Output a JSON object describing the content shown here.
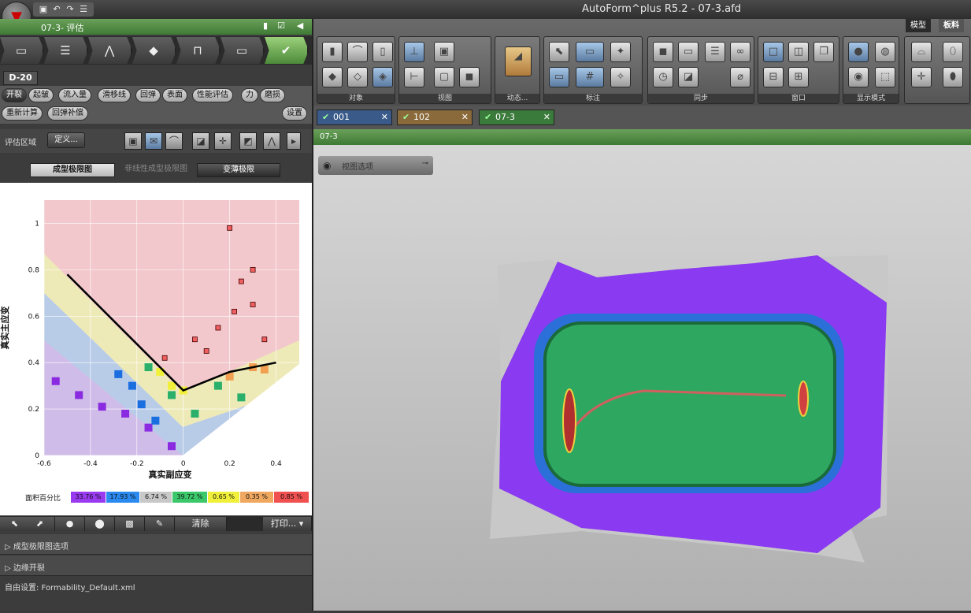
{
  "window": {
    "title": "AutoForm^plus R5.2 - 07-3.afd"
  },
  "left_panel": {
    "header": "07-3- 评估",
    "process_steps": [
      "零件",
      "工序",
      "模面",
      "板料",
      "工艺",
      "文本",
      "评估"
    ],
    "part_tab": "D-20",
    "eval_tabs_row1": [
      "开裂",
      "起皱",
      "流入量",
      "滑移线",
      "回弹",
      "表面",
      "性能评估",
      "力",
      "磨损"
    ],
    "eval_tabs_row2": [
      "重新计算",
      "回弹补偿"
    ],
    "settings_label": "设置",
    "eval_region_label": "评估区域",
    "define_button": "定义...",
    "view_tabs": [
      "成型极限图",
      "非线性成型极限图",
      "变薄极限"
    ]
  },
  "chart_data": {
    "type": "scatter",
    "title": "",
    "xlabel": "真实副应变",
    "ylabel": "真实主应变",
    "xlim": [
      -0.6,
      0.5
    ],
    "ylim": [
      0,
      1.1
    ],
    "x_ticks": [
      "-0.6",
      "-0.4",
      "-0.2",
      "0",
      "0.2",
      "0.4"
    ],
    "y_ticks": [
      "0",
      "0.2",
      "0.4",
      "0.6",
      "0.8",
      "1"
    ],
    "flc_curve": [
      [
        -0.5,
        0.78
      ],
      [
        0.0,
        0.28
      ],
      [
        0.2,
        0.36
      ],
      [
        0.4,
        0.4
      ]
    ],
    "series": [
      {
        "color": "#8a2be2",
        "values": [
          [
            -0.55,
            0.32
          ],
          [
            -0.45,
            0.26
          ],
          [
            -0.35,
            0.21
          ],
          [
            -0.25,
            0.18
          ],
          [
            -0.15,
            0.12
          ],
          [
            -0.05,
            0.04
          ]
        ]
      },
      {
        "color": "#1a6ee0",
        "values": [
          [
            -0.28,
            0.35
          ],
          [
            -0.22,
            0.3
          ],
          [
            -0.18,
            0.22
          ],
          [
            -0.12,
            0.15
          ]
        ]
      },
      {
        "color": "#2ab06a",
        "values": [
          [
            -0.15,
            0.38
          ],
          [
            -0.05,
            0.26
          ],
          [
            0.05,
            0.18
          ],
          [
            0.15,
            0.3
          ],
          [
            0.25,
            0.25
          ]
        ]
      },
      {
        "color": "#f0f03a",
        "values": [
          [
            -0.1,
            0.36
          ],
          [
            -0.05,
            0.3
          ],
          [
            0.0,
            0.28
          ]
        ]
      },
      {
        "color": "#f0a050",
        "values": [
          [
            0.2,
            0.34
          ],
          [
            0.3,
            0.38
          ],
          [
            0.35,
            0.37
          ]
        ]
      },
      {
        "color": "#f06060",
        "values": [
          [
            -0.08,
            0.42
          ],
          [
            0.05,
            0.5
          ],
          [
            0.15,
            0.55
          ],
          [
            0.22,
            0.62
          ],
          [
            0.25,
            0.75
          ],
          [
            0.3,
            0.8
          ],
          [
            0.2,
            0.98
          ],
          [
            0.35,
            0.5
          ],
          [
            0.1,
            0.45
          ],
          [
            0.3,
            0.65
          ]
        ]
      }
    ]
  },
  "legend": {
    "label": "面积百分比",
    "items": [
      {
        "text": "33.76 %",
        "color": "#9a3af0"
      },
      {
        "text": "17.93 %",
        "color": "#2a8af0"
      },
      {
        "text": "6.74 %",
        "color": "#c8c8c8"
      },
      {
        "text": "39.72 %",
        "color": "#3ac86a"
      },
      {
        "text": "0.65 %",
        "color": "#f0f03a"
      },
      {
        "text": "0.35 %",
        "color": "#f0a860"
      },
      {
        "text": "0.85 %",
        "color": "#f05050"
      }
    ]
  },
  "bottom_bar": {
    "clear_label": "清除",
    "print_label": "打印..."
  },
  "accordions": [
    "成型极限图选项",
    "边缘开裂"
  ],
  "status": "自由设置: Formability_Default.xml",
  "ribbon": {
    "tabs": [
      "模型",
      "板料"
    ],
    "groups": [
      "对象",
      "视图",
      "动态...",
      "标注",
      "同步",
      "窗口",
      "显示模式"
    ]
  },
  "models": [
    {
      "name": "001",
      "color": "#3a5a8a"
    },
    {
      "name": "102",
      "color": "#8a6a3a"
    },
    {
      "name": "07-3",
      "color": "#3a7a3a"
    }
  ],
  "viewport": {
    "header": "07-3",
    "view_options": "视图选项"
  }
}
